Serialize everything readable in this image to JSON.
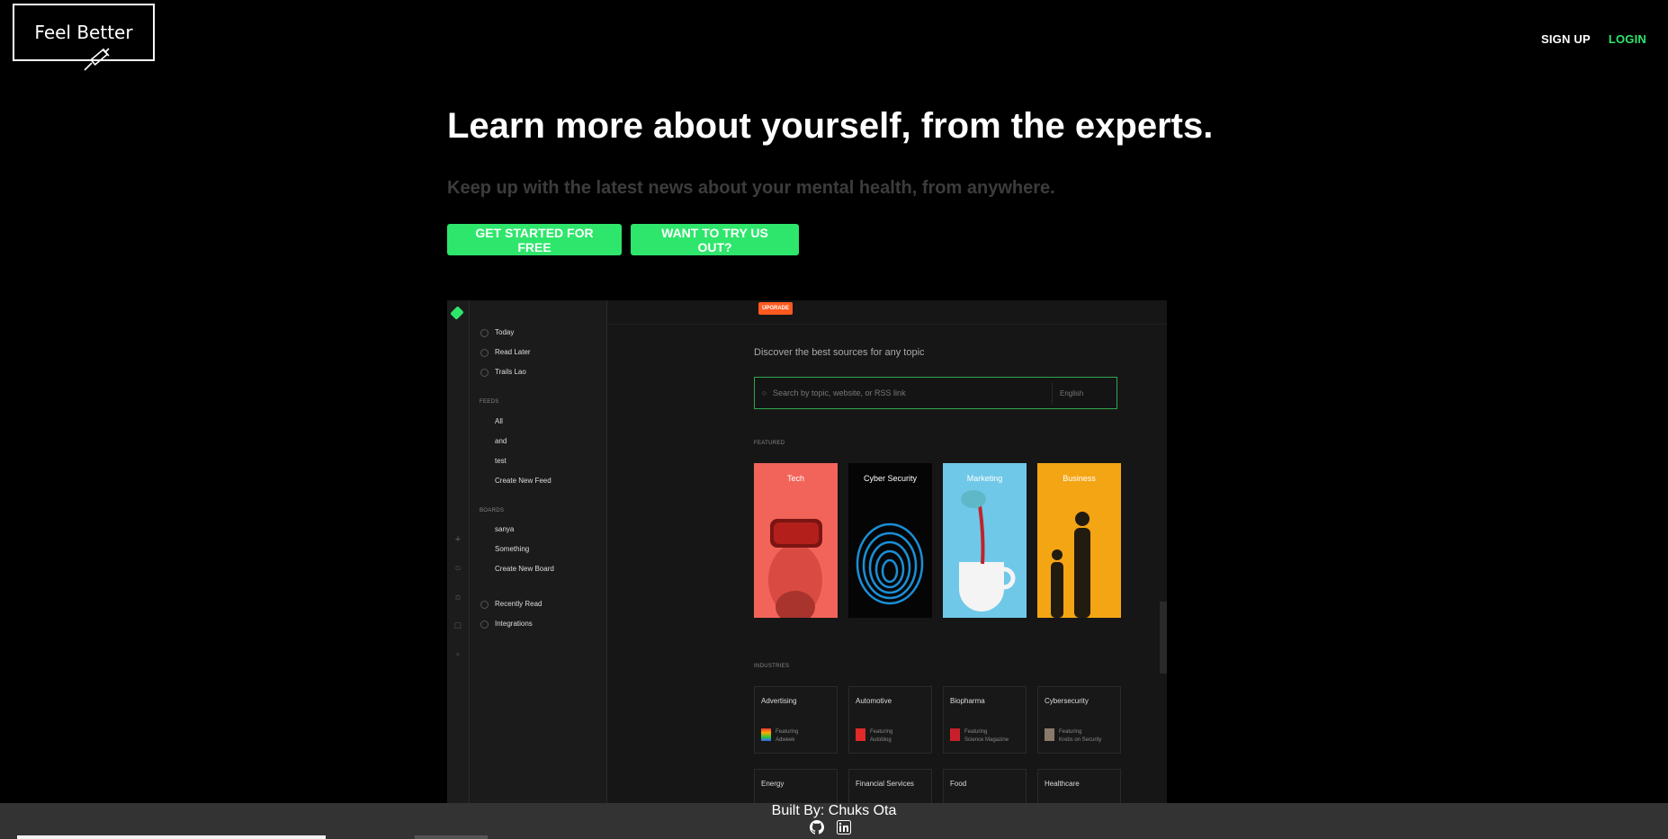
{
  "brand": {
    "name": "Feel Better"
  },
  "nav": {
    "signup": "SIGN UP",
    "login": "LOGIN"
  },
  "hero": {
    "title": "Learn more about yourself, from the experts.",
    "subtitle": "Keep up with the latest news about your mental health, from anywhere.",
    "cta_primary": "GET STARTED FOR FREE",
    "cta_secondary": "WANT TO TRY US OUT?"
  },
  "preview": {
    "upgrade": "UPGRADE",
    "sidebar": {
      "items": [
        "Today",
        "Read Later",
        "Trails Lao"
      ],
      "feeds_header": "FEEDS",
      "feeds": [
        "All",
        "and",
        "test",
        "Create New Feed"
      ],
      "boards_header": "BOARDS",
      "boards": [
        "sanya",
        "Something",
        "Create New Board"
      ],
      "bottom": [
        "Recently Read",
        "Integrations"
      ]
    },
    "discover": "Discover the best sources for any topic",
    "search_placeholder": "Search by topic, website, or RSS link",
    "language": "English",
    "featured_header": "FEATURED",
    "featured": [
      "Tech",
      "Cyber Security",
      "Marketing",
      "Business"
    ],
    "industries_header": "INDUSTRIES",
    "industries": [
      {
        "name": "Advertising",
        "featuring": "Featuring",
        "source": "Adweek"
      },
      {
        "name": "Automotive",
        "featuring": "Featuring",
        "source": "Autoblog"
      },
      {
        "name": "Biopharma",
        "featuring": "Featuring",
        "source": "Science Magazine"
      },
      {
        "name": "Cybersecurity",
        "featuring": "Featuring",
        "source": "Krebs on Security"
      }
    ],
    "industries_row2": [
      "Energy",
      "Financial Services",
      "Food",
      "Healthcare"
    ]
  },
  "footer": {
    "built_by": "Built By: Chuks Ota"
  },
  "colors": {
    "accent": "#2ee66b",
    "upgrade": "#ff5a1f",
    "footer": "#333333"
  }
}
